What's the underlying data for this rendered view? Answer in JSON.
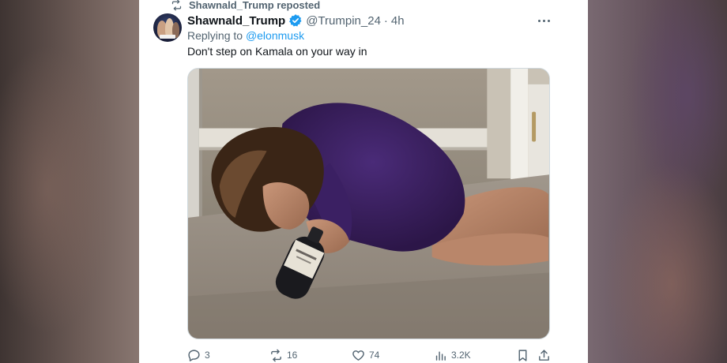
{
  "repost": {
    "label": "Shawnald_Trump reposted",
    "icon": "repost-icon"
  },
  "author": {
    "display_name": "Shawnald_Trump",
    "handle": "@Trumpin_24",
    "separator": "·",
    "time": "4h",
    "verified": true,
    "verified_color": "#1d9bf0"
  },
  "reply": {
    "prefix": "Replying to",
    "mention": "@elonmusk"
  },
  "tweet": {
    "text": "Don't step on Kamala on your way in"
  },
  "actions": {
    "replies": "3",
    "reposts": "16",
    "likes": "74",
    "views": "3.2K"
  },
  "icons": [
    "repost-icon",
    "verified-badge-icon",
    "more-icon",
    "reply-icon",
    "retweet-icon",
    "like-icon",
    "views-icon",
    "bookmark-icon",
    "share-icon"
  ],
  "colors": {
    "text": "#0f1419",
    "secondary": "#536471",
    "accent": "#1d9bf0"
  }
}
